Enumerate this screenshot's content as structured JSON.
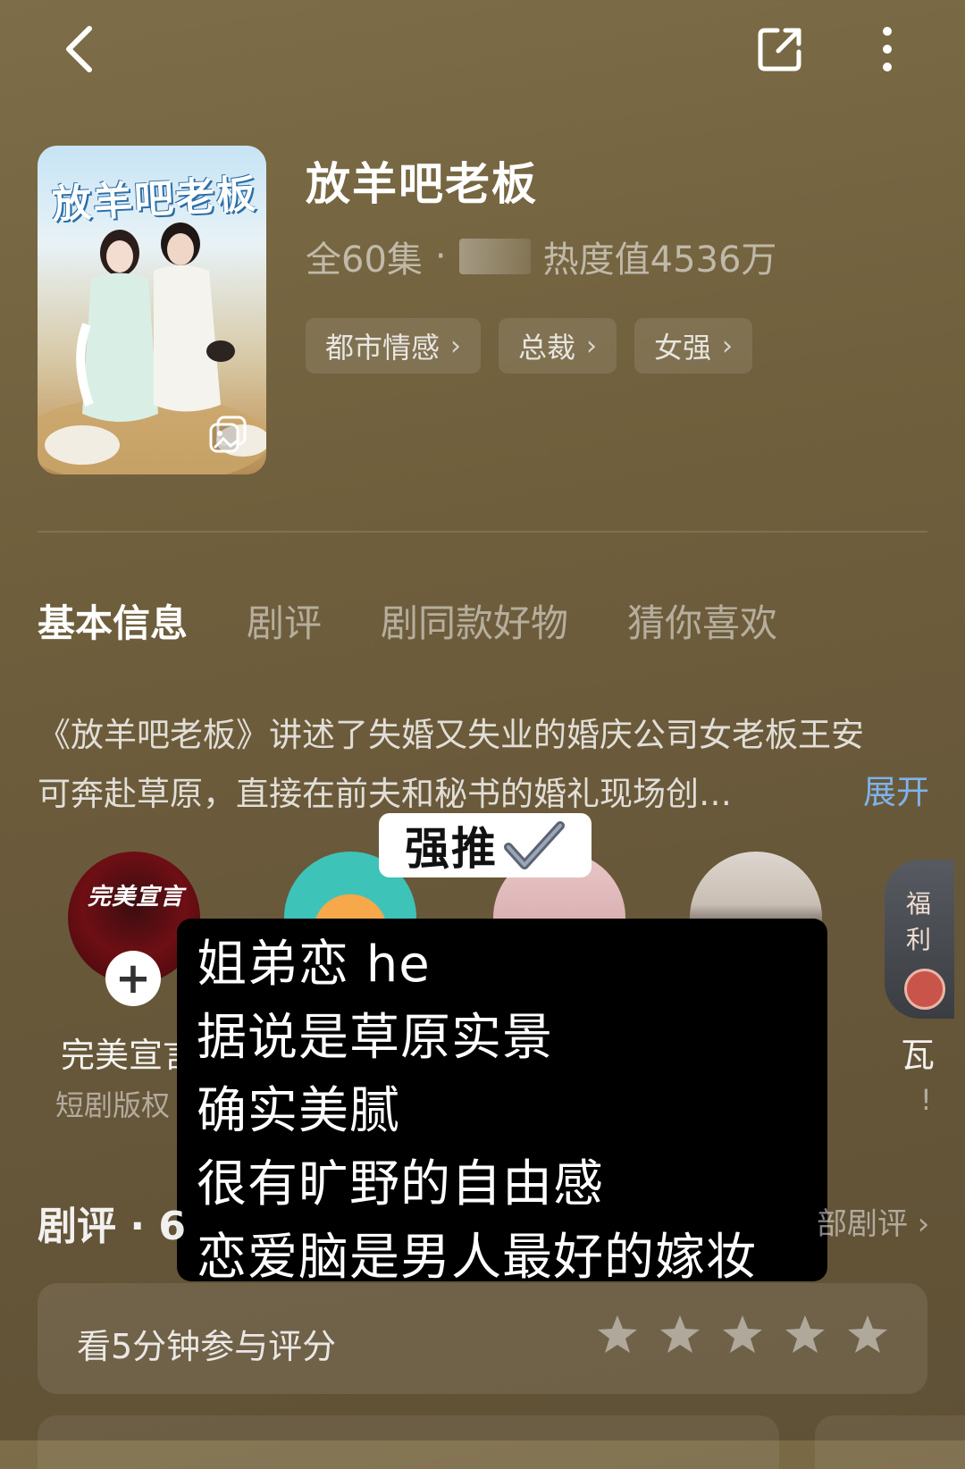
{
  "drama": {
    "title": "放羊吧老板",
    "episodes": "全60集",
    "dot": "·",
    "heat": "热度值4536万",
    "poster_title": "放羊吧老板",
    "tags": [
      {
        "label": "都市情感"
      },
      {
        "label": "总裁"
      },
      {
        "label": "女强"
      }
    ]
  },
  "tabs": [
    {
      "label": "基本信息"
    },
    {
      "label": "剧评"
    },
    {
      "label": "剧同款好物"
    },
    {
      "label": "猜你喜欢"
    }
  ],
  "synopsis": {
    "line1": "《放羊吧老板》讲述了失婚又失业的婚庆公司女老板王安",
    "line2": "可奔赴草原，直接在前夫和秘书的婚礼现场创…",
    "expand": "展开"
  },
  "cast": {
    "first_logo": "完美宣言",
    "first_name": "完美宣言",
    "first_role": "短剧版权",
    "last_name": "瓦",
    "last_role": "!",
    "welfare": "福利"
  },
  "overlay": {
    "badge": "强推",
    "lines": [
      "姐弟恋 he",
      "据说是草原实景",
      "确实美腻",
      "很有旷野的自由感",
      "恋爱脑是男人最好的嫁妆"
    ]
  },
  "reviews": {
    "title": "剧评 · 6",
    "more": "部剧评 ›",
    "rating_prompt": "看5分钟参与评分",
    "stars": 5
  },
  "colors": {
    "background": "#6f5f3c",
    "accent": "#7fb2ea"
  },
  "icons": [
    "back-arrow-icon",
    "share-icon",
    "more-vertical-icon",
    "gallery-icon",
    "plus-icon",
    "check-icon",
    "star-icon",
    "chevron-right-icon"
  ]
}
